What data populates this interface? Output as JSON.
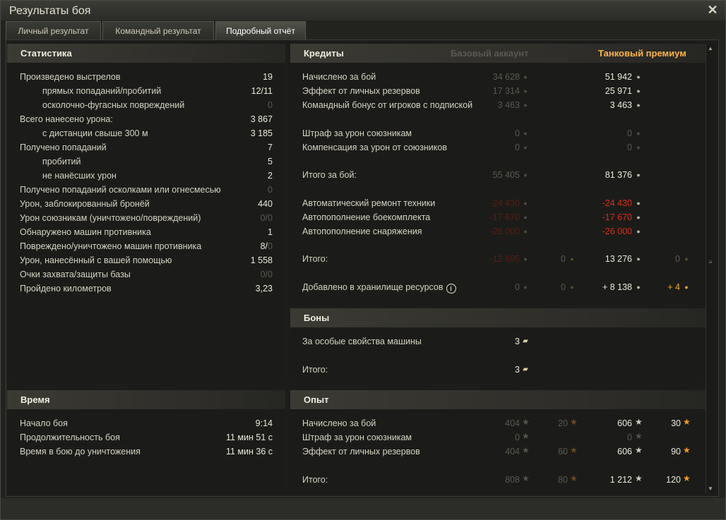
{
  "window": {
    "title": "Результаты боя",
    "close_icon": "close-icon"
  },
  "tabs": [
    {
      "label": "Личный результат",
      "active": false
    },
    {
      "label": "Командный результат",
      "active": false
    },
    {
      "label": "Подробный отчёт",
      "active": true
    }
  ],
  "stats": {
    "header": "Статистика",
    "rows": [
      {
        "label": "Произведено выстрелов",
        "value": "19"
      },
      {
        "label": "прямых попаданий/пробитий",
        "value": "12/11"
      },
      {
        "label": "осколочно-фугасных повреждений",
        "value": "0"
      },
      {
        "label": "Всего нанесено урона:",
        "value": "3 867"
      },
      {
        "label": "с дистанции свыше 300 м",
        "value": "3 185"
      },
      {
        "label": "Получено попаданий",
        "value": "7"
      },
      {
        "label": "пробитий",
        "value": "5"
      },
      {
        "label": "не нанёсших урон",
        "value": "2"
      },
      {
        "label": "Получено попаданий осколками или огнесмесью",
        "value": "0"
      },
      {
        "label": "Урон, заблокированный бронёй",
        "value": "440"
      },
      {
        "label": "Урон союзникам (уничтожено/повреждений)",
        "value": "0/0"
      },
      {
        "label": "Обнаружено машин противника",
        "value": "1"
      },
      {
        "label": "Повреждено/уничтожено машин противника",
        "value_a": "8/",
        "value_b": "0"
      },
      {
        "label": "Урон, нанесённый с вашей помощью",
        "value": "1 558"
      },
      {
        "label": "Очки захвата/защиты базы",
        "value": "0/0"
      },
      {
        "label": "Пройдено километров",
        "value": "3,23"
      }
    ]
  },
  "time": {
    "header": "Время",
    "rows": [
      {
        "label": "Начало боя",
        "value": "9:14"
      },
      {
        "label": "Продолжительность боя",
        "value": "11 мин 51 с"
      },
      {
        "label": "Время в бою до уничтожения",
        "value": "11 мин 36 с"
      }
    ]
  },
  "credits": {
    "header": "Кредиты",
    "col_base": "Базовый аккаунт",
    "col_premium": "Танковый премиум",
    "rows": [
      {
        "label": "Начислено за бой",
        "base": "34 628",
        "prem": "51 942"
      },
      {
        "label": "Эффект от личных резервов",
        "base": "17 314",
        "prem": "25 971"
      },
      {
        "label": "Командный бонус от игроков с подпиской",
        "base": "3 463",
        "prem": "3 463"
      },
      {
        "label": "Штраф за урон союзникам",
        "base": "0",
        "prem": "0"
      },
      {
        "label": "Компенсация за урон от союзников",
        "base": "0",
        "prem": "0"
      },
      {
        "label": "Итого за бой:",
        "base": "55 405",
        "prem": "81 376"
      },
      {
        "label": "Автоматический ремонт техники",
        "base": "-24 430",
        "prem": "-24 430"
      },
      {
        "label": "Автопополнение боекомплекта",
        "base": "-17 670",
        "prem": "-17 670"
      },
      {
        "label": "Автопополнение снаряжения",
        "base": "-26 000",
        "prem": "-26 000"
      },
      {
        "label": "Итого:",
        "base": "-12 695",
        "base_gold": "0",
        "prem": "13 276",
        "prem_gold": "0"
      },
      {
        "label": "Добавлено в хранилище ресурсов",
        "base": "0",
        "base_gold": "0",
        "prem": "+ 8 138",
        "prem_gold": "+ 4"
      }
    ]
  },
  "bonds": {
    "header": "Боны",
    "rows": [
      {
        "label": "За особые свойства машины",
        "value": "3"
      },
      {
        "label": "Итого:",
        "value": "3"
      }
    ]
  },
  "experience": {
    "header": "Опыт",
    "rows": [
      {
        "label": "Начислено за бой",
        "base": "404",
        "base_free": "20",
        "prem": "606",
        "prem_free": "30"
      },
      {
        "label": "Штраф за урон союзникам",
        "base": "0",
        "prem": "0"
      },
      {
        "label": "Эффект от личных резервов",
        "base": "404",
        "base_free": "60",
        "prem": "606",
        "prem_free": "90"
      },
      {
        "label": "Итого:",
        "base": "808",
        "base_free": "80",
        "prem": "1 212",
        "prem_free": "120"
      }
    ]
  },
  "icons": {
    "credit": "credit-coin-icon",
    "gold": "gold-coin-icon",
    "bond": "bond-icon",
    "xp": "xp-star-icon",
    "free_xp": "free-xp-star-icon",
    "info": "info-icon"
  }
}
